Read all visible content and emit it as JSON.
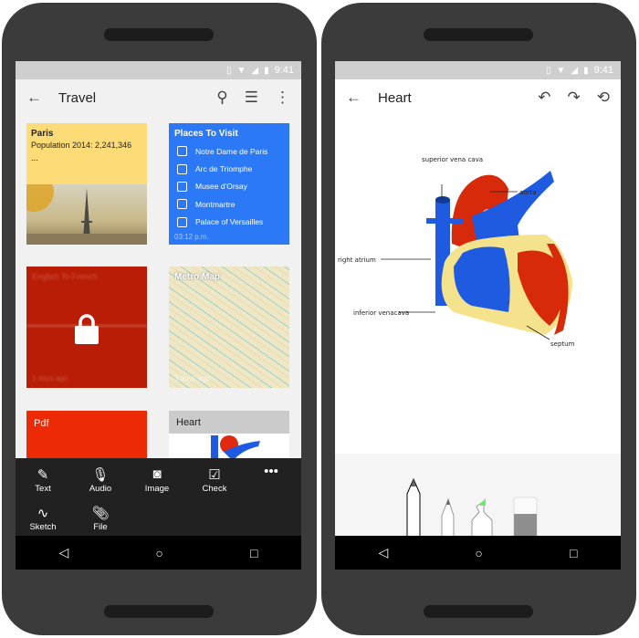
{
  "status": {
    "time": "9:41"
  },
  "left": {
    "title": "Travel",
    "cards": {
      "paris": {
        "title": "Paris",
        "body": "Population 2014: 2,241,346",
        "ellipsis": "..."
      },
      "places": {
        "title": "Places To Visit",
        "items": [
          "Notre Dame de Paris",
          "Arc de Triomphe",
          "Musee d'Orsay",
          "Montmartre",
          "Palace of Versailles"
        ],
        "time": "03:12 p.m."
      },
      "locked": {
        "title": "English To French",
        "ago": "3 days ago"
      },
      "metro": {
        "title": "Metro Map",
        "ago": "3 days ago"
      },
      "pdf": {
        "title": "Pdf"
      },
      "heart": {
        "title": "Heart"
      }
    },
    "tools": {
      "text": "Text",
      "audio": "Audio",
      "image": "Image",
      "check": "Check",
      "sketch": "Sketch",
      "file": "File"
    }
  },
  "right": {
    "title": "Heart",
    "labels": {
      "svc": "superior vena cava",
      "aorta": "aorta",
      "ra": "right atrium",
      "ivc": "inferior venacava",
      "septum": "septum"
    }
  },
  "colors": {
    "blue_card": "#2b79f6",
    "yellow_card": "#fddb77",
    "red_card": "#b91d05",
    "pdf_card": "#ec2a06",
    "toolbar": "#212121",
    "highlighter": "#6ee86e"
  }
}
